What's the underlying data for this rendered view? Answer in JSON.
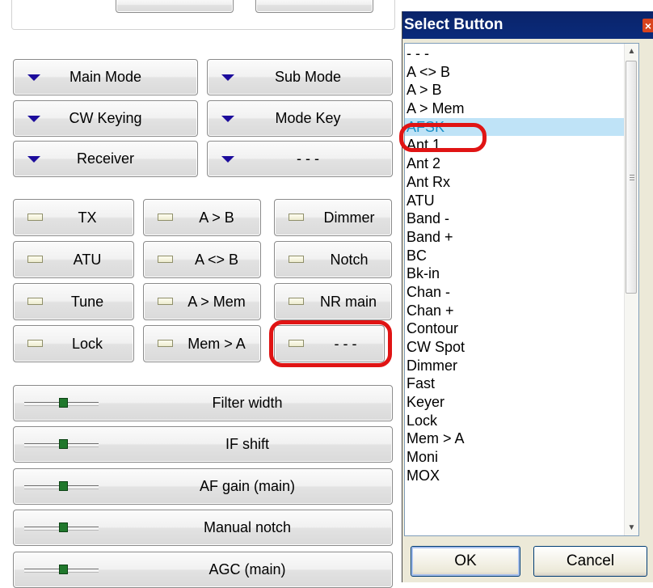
{
  "control_panel": {
    "dropdowns": [
      {
        "label": "Main Mode"
      },
      {
        "label": "Sub Mode"
      },
      {
        "label": "CW Keying"
      },
      {
        "label": "Mode Key"
      },
      {
        "label": "Receiver"
      },
      {
        "label": "- - -"
      }
    ],
    "toggles": [
      {
        "label": "TX"
      },
      {
        "label": "A > B"
      },
      {
        "label": "Dimmer"
      },
      {
        "label": "ATU"
      },
      {
        "label": "A <> B"
      },
      {
        "label": "Notch"
      },
      {
        "label": "Tune"
      },
      {
        "label": "A > Mem"
      },
      {
        "label": "NR main"
      },
      {
        "label": "Lock"
      },
      {
        "label": "Mem > A"
      },
      {
        "label": "- - -"
      }
    ],
    "sliders": [
      {
        "label": "Filter width"
      },
      {
        "label": "IF shift"
      },
      {
        "label": "AF gain (main)"
      },
      {
        "label": "Manual notch"
      },
      {
        "label": "AGC (main)"
      }
    ]
  },
  "dialog": {
    "title": "Select Button",
    "close_glyph": "×",
    "selected_item": "AFSK",
    "items": [
      "- - -",
      "A <> B",
      "A > B",
      "A > Mem",
      "AFSK",
      "Ant 1",
      "Ant 2",
      "Ant Rx",
      "ATU",
      "Band -",
      "Band +",
      "BC",
      "Bk-in",
      "Chan -",
      "Chan +",
      "Contour",
      "CW Spot",
      "Dimmer",
      "Fast",
      "Keyer",
      "Lock",
      "Mem > A",
      "Moni",
      "MOX"
    ],
    "ok_label": "OK",
    "cancel_label": "Cancel"
  },
  "icons": {
    "dropdown_arrow": "dropdown-arrow-icon",
    "led": "led-indicator-icon",
    "slider": "slider-icon",
    "scroll_up": "scroll-up-arrow-icon",
    "scroll_down": "scroll-down-arrow-icon"
  },
  "colors": {
    "highlight_marker": "#e01414",
    "selection_bg": "#bfe3f7",
    "selection_text": "#1a8fc6",
    "titlebar": "#0a246a",
    "dropdown_arrow": "#1c0c9c",
    "slider_thumb": "#20782c"
  }
}
